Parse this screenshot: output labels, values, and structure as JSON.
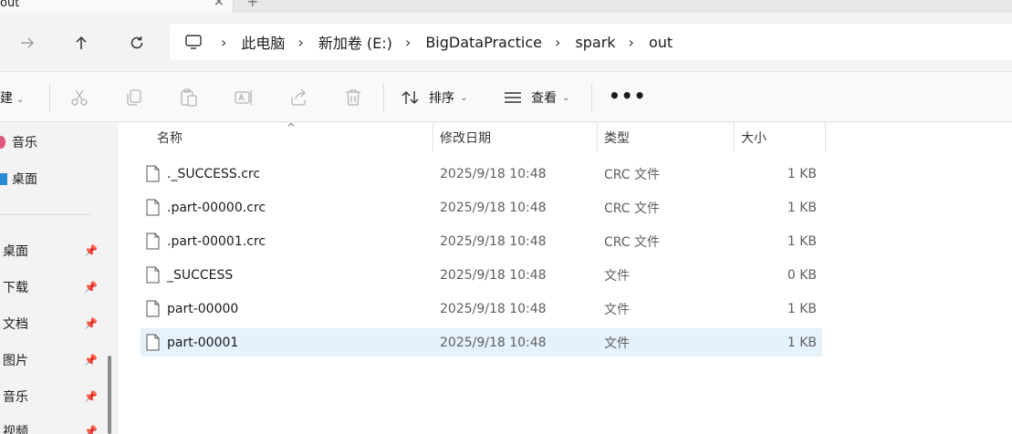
{
  "tab": {
    "title": "out",
    "close": "×",
    "new": "+"
  },
  "nav": {
    "back_icon": "arrow-left-icon",
    "forward_icon": "arrow-right-icon",
    "up_icon": "arrow-up-icon",
    "refresh_icon": "refresh-icon",
    "breadcrumbs": [
      "此电脑",
      "新加卷 (E:)",
      "BigDataPractice",
      "spark",
      "out"
    ]
  },
  "commands": {
    "new_label": "建",
    "sort_label": "排序",
    "view_label": "查看",
    "more_label": "•••",
    "icons": [
      "cut-icon",
      "copy-icon",
      "paste-icon",
      "rename-icon",
      "share-icon",
      "delete-icon"
    ]
  },
  "sidebar": {
    "top_items": [
      {
        "label": "音乐",
        "icon": "music-icon"
      },
      {
        "label": "桌面",
        "icon": "desktop-icon"
      }
    ],
    "pinned_items": [
      {
        "label": "桌面"
      },
      {
        "label": "下载"
      },
      {
        "label": "文档"
      },
      {
        "label": "图片"
      },
      {
        "label": "音乐"
      },
      {
        "label": "视频"
      }
    ]
  },
  "list": {
    "columns": {
      "name": "名称",
      "modified": "修改日期",
      "type": "类型",
      "size": "大小"
    },
    "rows": [
      {
        "name": "._SUCCESS.crc",
        "modified": "2025/9/18 10:48",
        "type": "CRC 文件",
        "size": "1 KB",
        "selected": false
      },
      {
        "name": ".part-00000.crc",
        "modified": "2025/9/18 10:48",
        "type": "CRC 文件",
        "size": "1 KB",
        "selected": false
      },
      {
        "name": ".part-00001.crc",
        "modified": "2025/9/18 10:48",
        "type": "CRC 文件",
        "size": "1 KB",
        "selected": false
      },
      {
        "name": "_SUCCESS",
        "modified": "2025/9/18 10:48",
        "type": "文件",
        "size": "0 KB",
        "selected": false
      },
      {
        "name": "part-00000",
        "modified": "2025/9/18 10:48",
        "type": "文件",
        "size": "1 KB",
        "selected": false
      },
      {
        "name": "part-00001",
        "modified": "2025/9/18 10:48",
        "type": "文件",
        "size": "1 KB",
        "selected": true
      }
    ]
  }
}
